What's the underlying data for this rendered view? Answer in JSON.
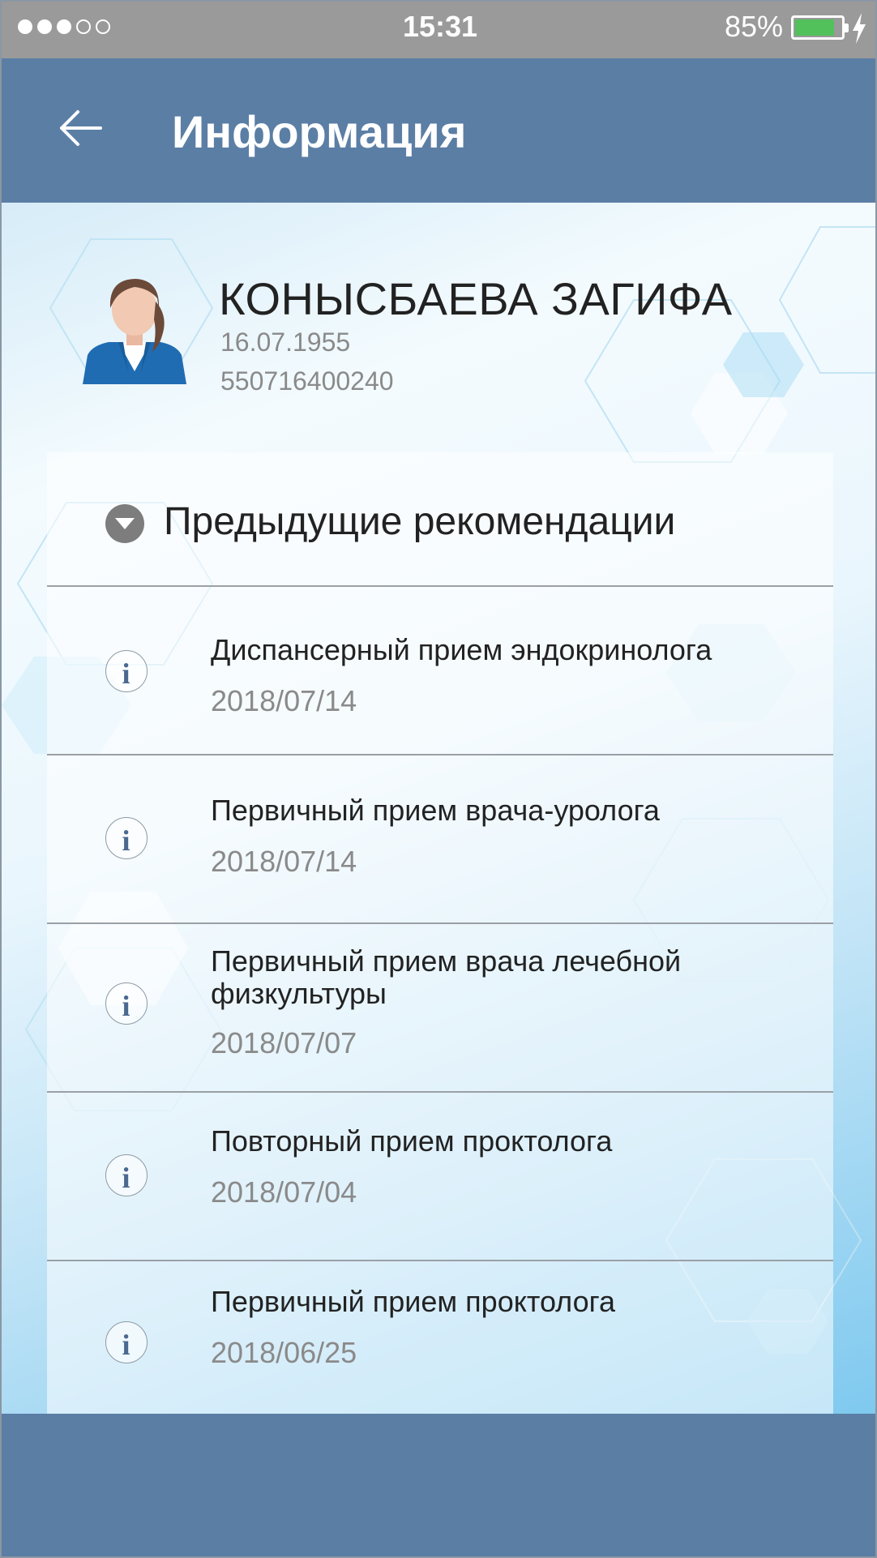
{
  "status_bar": {
    "time": "15:31",
    "battery_percent": "85%",
    "battery_level": 0.85,
    "signal_bars_filled": 3,
    "signal_bars_total": 5
  },
  "header": {
    "title": "Информация",
    "back_icon": "arrow-left-icon"
  },
  "patient": {
    "name": "КОНЫСБАЕВА ЗАГИФА",
    "birth_date": "16.07.1955",
    "iin": "550716400240"
  },
  "section": {
    "title": "Предыдущие рекомендации",
    "expanded": true
  },
  "recommendations": [
    {
      "title": "Диспансерный прием эндокринолога",
      "date": "2018/07/14"
    },
    {
      "title": "Первичный прием врача-уролога",
      "date": "2018/07/14"
    },
    {
      "title": "Первичный прием врача лечебной физкультуры",
      "date": "2018/07/07"
    },
    {
      "title": "Повторный прием проктолога",
      "date": "2018/07/04"
    },
    {
      "title": "Первичный прием проктолога",
      "date": "2018/06/25"
    }
  ],
  "colors": {
    "header": "#5b7ea5",
    "status_bar": "#9a9a9a",
    "battery_fill": "#52c05b"
  }
}
